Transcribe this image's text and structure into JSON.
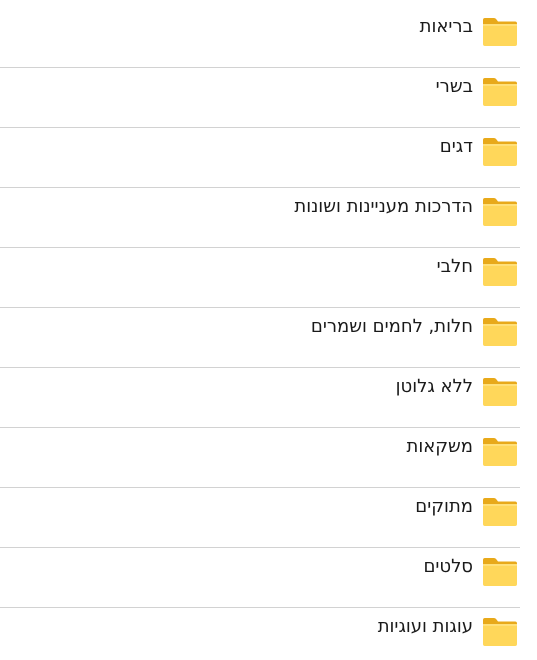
{
  "folders": [
    {
      "label": "בריאות",
      "icon": "folder-icon"
    },
    {
      "label": "בשרי",
      "icon": "folder-icon"
    },
    {
      "label": "דגים",
      "icon": "folder-icon"
    },
    {
      "label": "הדרכות מעניינות ושונות",
      "icon": "folder-icon"
    },
    {
      "label": "חלבי",
      "icon": "folder-icon"
    },
    {
      "label": "חלות, לחמים ושמרים",
      "icon": "folder-icon"
    },
    {
      "label": "ללא גלוטן",
      "icon": "folder-icon"
    },
    {
      "label": "משקאות",
      "icon": "folder-icon"
    },
    {
      "label": "מתוקים",
      "icon": "folder-icon"
    },
    {
      "label": "סלטים",
      "icon": "folder-icon"
    },
    {
      "label": "עוגות ועוגיות",
      "icon": "folder-icon"
    }
  ],
  "colors": {
    "folder_back": "#e8a91a",
    "folder_front": "#ffd75a",
    "folder_front_light": "#ffe07a",
    "divider": "#d2d2d2",
    "text": "#1a1a1a"
  }
}
